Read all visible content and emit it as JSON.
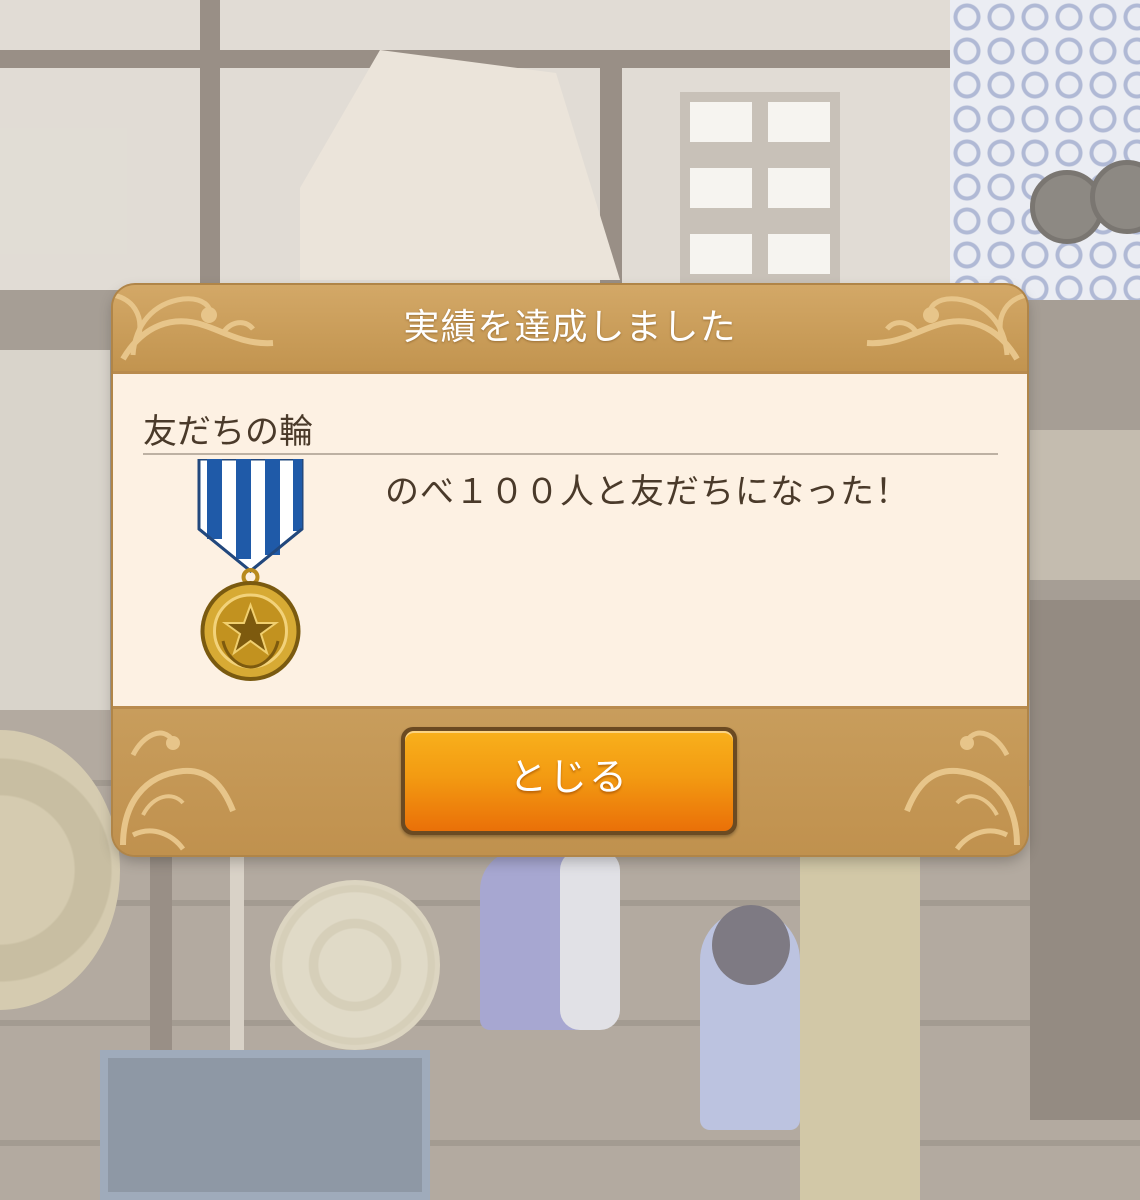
{
  "dialog": {
    "title": "実績を達成しました",
    "achievement_name": "友だちの輪",
    "description": "のべ１００人と友だちになった！",
    "close_label": "とじる",
    "medal_icon": "medal-icon"
  },
  "colors": {
    "frame": "#c79b5a",
    "body": "#fdf1e3",
    "button": "#f39b12",
    "ribbon_blue": "#1f5aa8"
  }
}
